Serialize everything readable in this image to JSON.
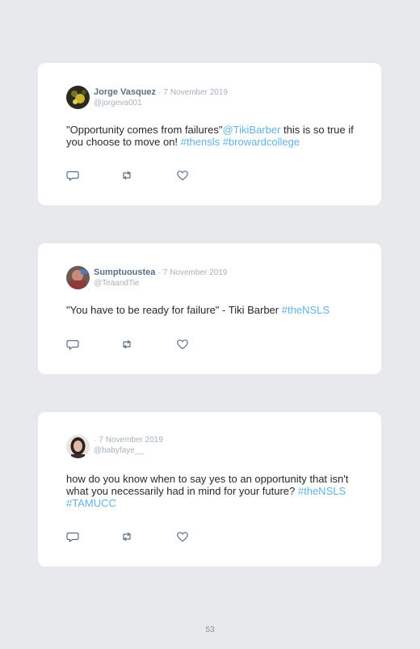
{
  "tweets": [
    {
      "author": "Jorge Vasquez",
      "separator": "·",
      "date": "7 November 2019",
      "handle": "@jorgeva001",
      "text_parts": [
        {
          "text": "\"Opportunity comes from failures\"",
          "link": false
        },
        {
          "text": "@TikiBarber",
          "link": true
        },
        {
          "text": " this is so true if you choose to move on! ",
          "link": false
        },
        {
          "text": "#thensls",
          "link": true
        },
        {
          "text": " ",
          "link": false
        },
        {
          "text": "#browardcollege",
          "link": true
        }
      ]
    },
    {
      "author": "Sumptuoustea",
      "separator": "·",
      "date": "7 November 2019",
      "handle": "@TeaandTie",
      "text_parts": [
        {
          "text": "\"You have to be ready for failure\" - Tiki Barber ",
          "link": false
        },
        {
          "text": "#theNSLS",
          "link": true
        }
      ]
    },
    {
      "author": "",
      "separator": "·",
      "date": "7 November 2019",
      "handle": "@babyfaye__",
      "text_parts": [
        {
          "text": "how do you know when to say yes to an opportunity that isn't what you necessarily had in mind for your future? ",
          "link": false
        },
        {
          "text": "#theNSLS",
          "link": true
        },
        {
          "text": " ",
          "link": false
        },
        {
          "text": "#TAMUCC",
          "link": true
        }
      ]
    }
  ],
  "icons": {
    "reply": "reply-icon",
    "retweet": "retweet-icon",
    "like": "heart-icon"
  },
  "colors": {
    "background": "#e8e9ed",
    "card": "#ffffff",
    "author": "#5b6f86",
    "muted": "#a6b2bf",
    "link": "#63b3e4",
    "icon": "#5b6f86"
  },
  "page_number": "53"
}
